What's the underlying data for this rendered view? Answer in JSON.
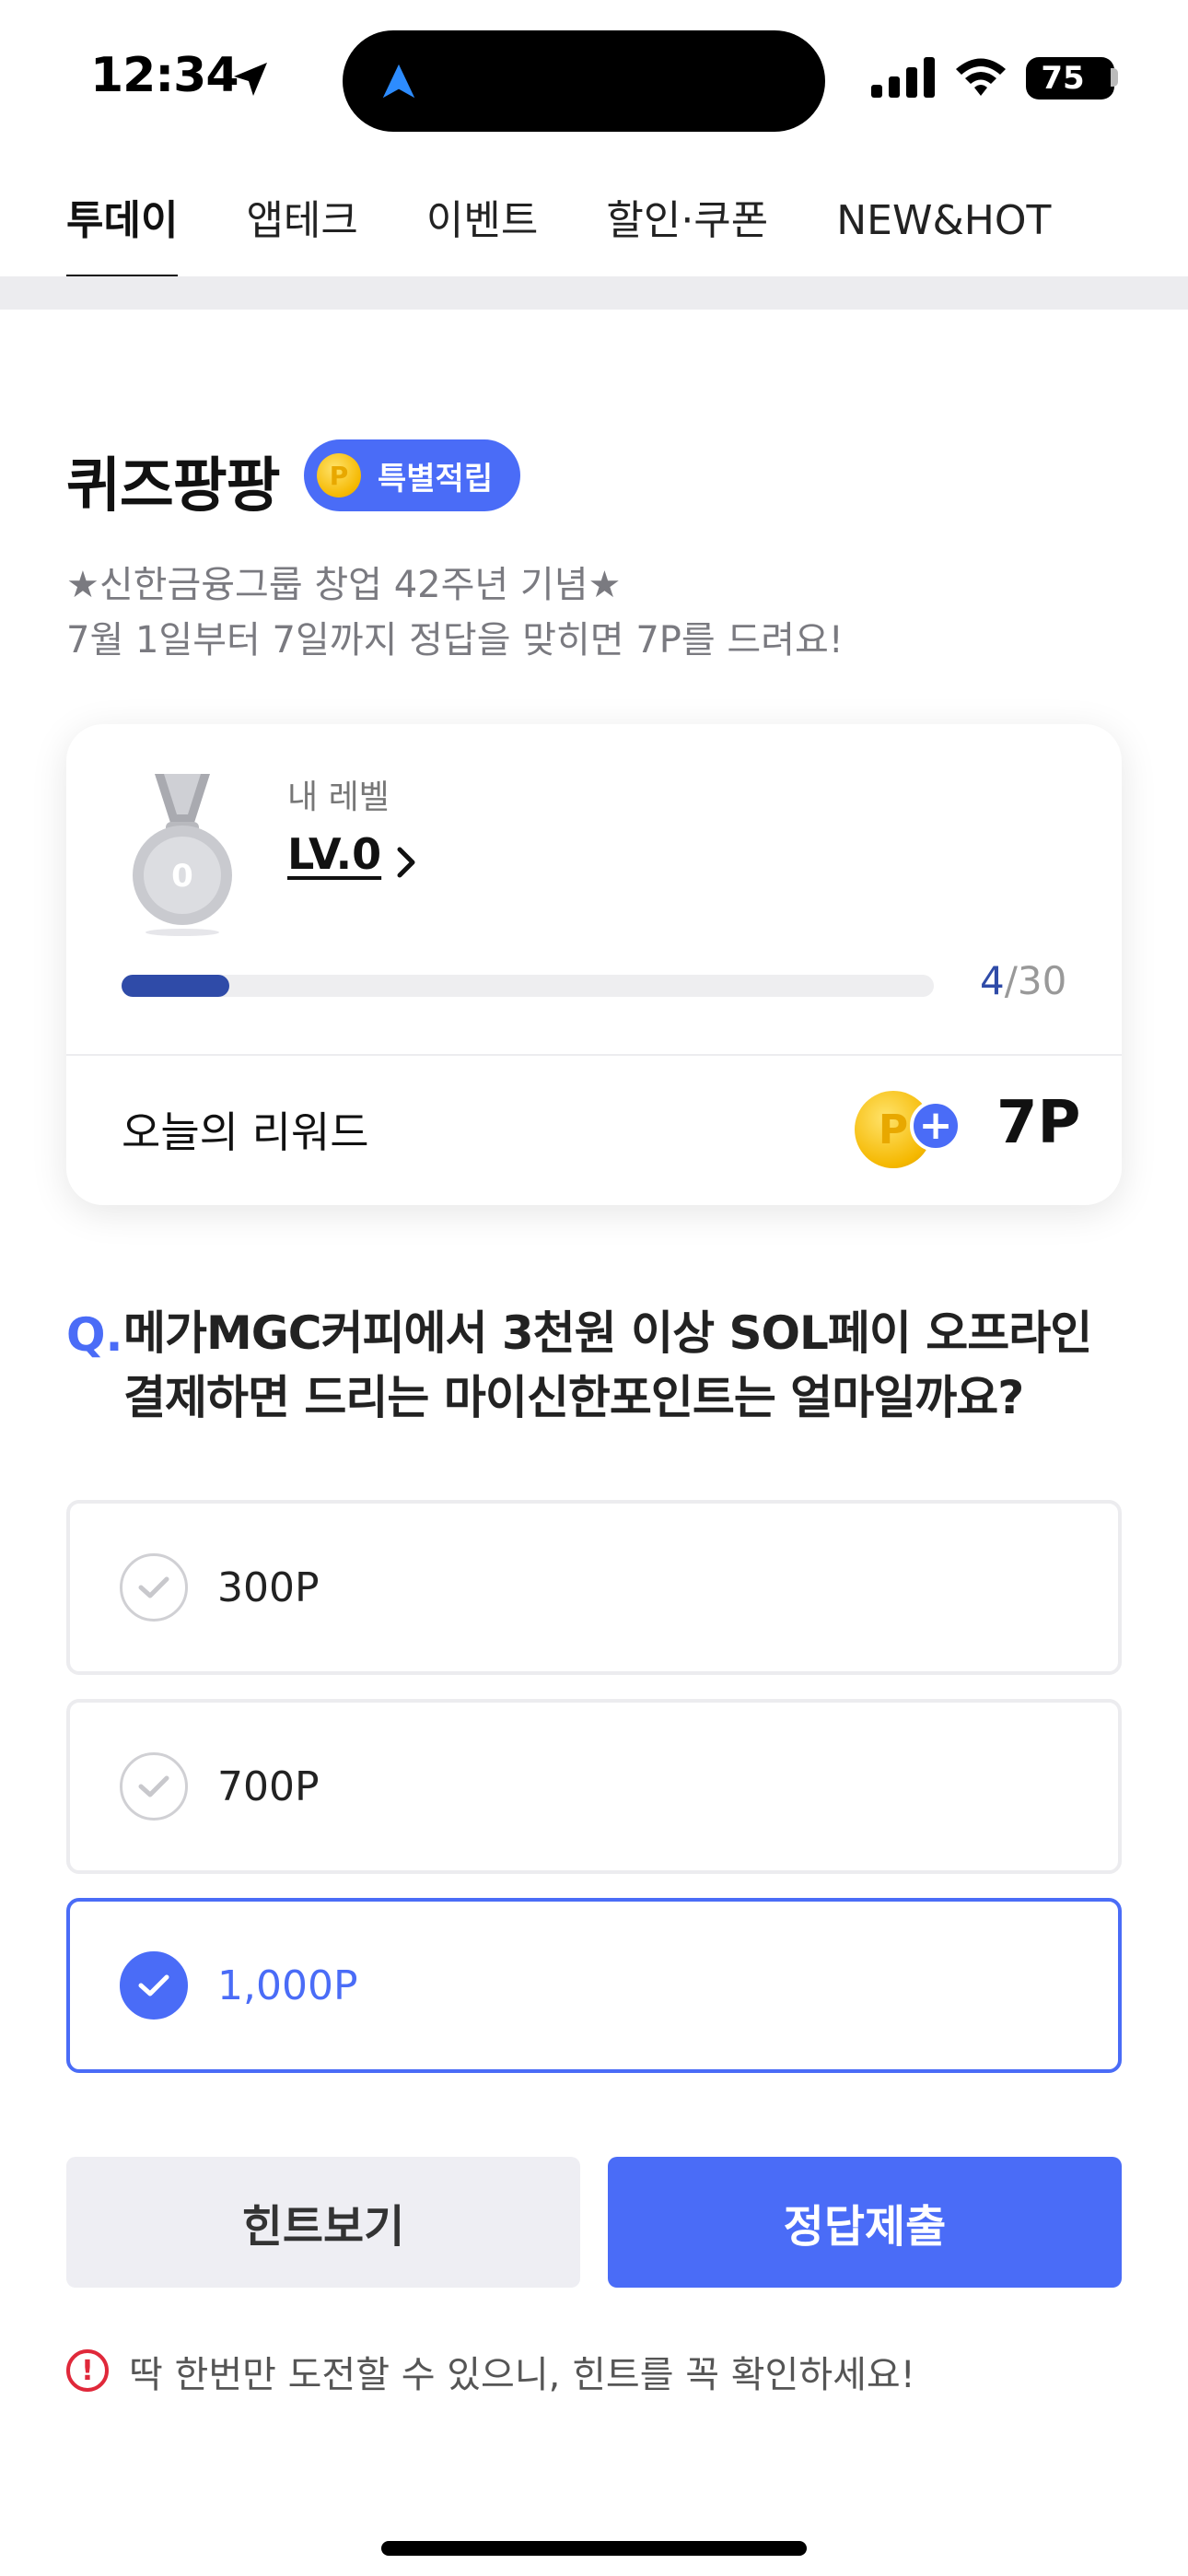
{
  "status_bar": {
    "time": "12:34",
    "battery": "75"
  },
  "tabs": [
    {
      "label": "투데이",
      "active": true
    },
    {
      "label": "앱테크",
      "active": false
    },
    {
      "label": "이벤트",
      "active": false
    },
    {
      "label": "할인·쿠폰",
      "active": false
    },
    {
      "label": "NEW&HOT",
      "active": false
    }
  ],
  "quiz": {
    "title": "퀴즈팡팡",
    "badge": "특별적립",
    "badge_coin": "P",
    "desc_line1": "★신한금융그룹 창업 42주년 기념★",
    "desc_line2": "7월 1일부터 7일까지 정답을 맞히면 7P를 드려요!"
  },
  "level_card": {
    "medal_number": "0",
    "label": "내 레벨",
    "level": "LV.0",
    "progress_current": "4",
    "progress_sep": "/",
    "progress_total": "30",
    "progress_fraction": 0.133,
    "reward_label": "오늘의 리워드",
    "reward_coin": "P",
    "reward_plus": "+",
    "reward_value": "7P"
  },
  "question": {
    "prefix": "Q.",
    "text": "메가MGC커피에서 3천원 이상 SOL페이 오프라인 결제하면 드리는 마이신한포인트는 얼마일까요?"
  },
  "options": [
    {
      "label": "300P",
      "selected": false
    },
    {
      "label": "700P",
      "selected": false
    },
    {
      "label": "1,000P",
      "selected": true
    }
  ],
  "buttons": {
    "hint": "힌트보기",
    "submit": "정답제출"
  },
  "warning": {
    "icon": "!",
    "text": "딱 한번만 도전할 수 있으니, 힌트를 꼭 확인하세요!"
  },
  "colors": {
    "accent": "#4a6cf7",
    "progress": "#2f4ba8",
    "warning": "#e0283a"
  }
}
